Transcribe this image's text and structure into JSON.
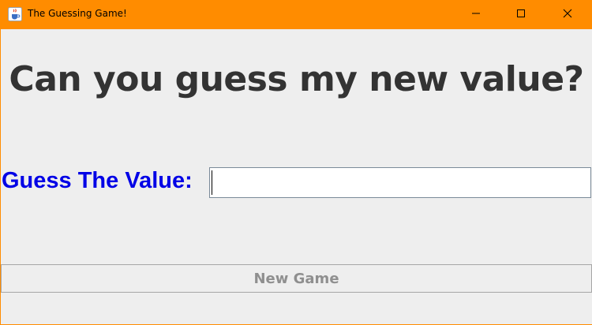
{
  "window": {
    "title": "The Guessing Game!",
    "icons": {
      "app": "java-cup-icon",
      "minimize": "minimize-icon",
      "maximize": "maximize-icon",
      "close": "close-icon"
    },
    "title_bar_color": "#ff8c00"
  },
  "main": {
    "heading": "Can you guess my new value?",
    "guess_label": "Guess The Value:",
    "guess_input_value": "",
    "new_game_label": "New Game",
    "new_game_enabled": false,
    "colors": {
      "heading": "#333333",
      "label": "#0000e6",
      "disabled_text": "#8f8f8f",
      "background": "#eeeeee"
    }
  }
}
